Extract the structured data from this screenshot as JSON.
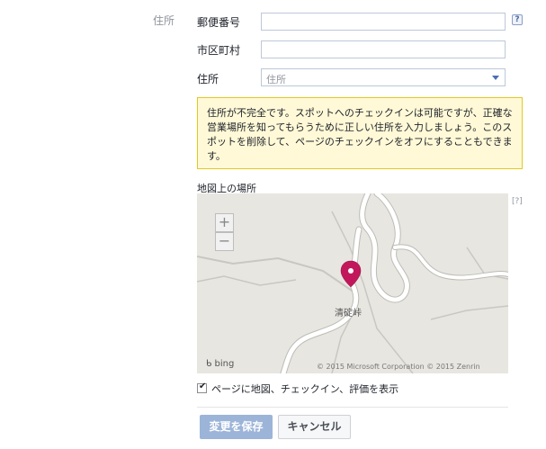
{
  "section": {
    "label": "住所"
  },
  "fields": {
    "postal_label": "郵便番号",
    "city_label": "市区町村",
    "address_label": "住所",
    "address_select_value": "住所",
    "help": "?"
  },
  "warning": {
    "text": "住所が不完全です。スポットへのチェックインは可能ですが、正確な営業場所を知ってもらうために正しい住所を入力しましょう。このスポットを削除して、ページのチェックインをオフにすることもできます。"
  },
  "map": {
    "title": "地図上の場所",
    "help": "[?]",
    "place_label": "清碇峠",
    "zoom_in": "+",
    "zoom_out": "−",
    "provider": "bing",
    "credit": "© 2015 Microsoft Corporation  © 2015 Zenrin",
    "marker_color": "#c2185b"
  },
  "show_map": {
    "checked": true,
    "label": "ページに地図、チェックイン、評価を表示"
  },
  "buttons": {
    "save": "変更を保存",
    "cancel": "キャンセル"
  },
  "colors": {
    "warning_bg": "#fff9d7",
    "warning_border": "#e2c822",
    "save_button": "#9cb4d8"
  }
}
